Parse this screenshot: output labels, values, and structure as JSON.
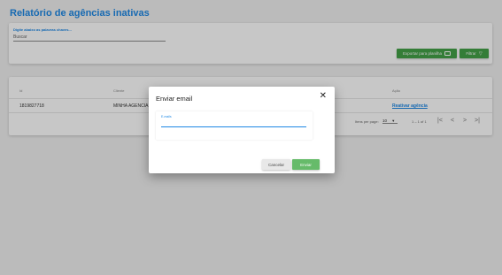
{
  "header": {
    "title": "Relatório de agências inativas"
  },
  "search": {
    "hint": "Digite abaixo as palavras chaves...",
    "label": "Buscar"
  },
  "actions": {
    "export_label": "Exportar para planilha",
    "filter_label": "Filtrar"
  },
  "table": {
    "columns": [
      "Id",
      "Cliente",
      "Ação"
    ],
    "rows": [
      {
        "id": "1819827718",
        "client": "MINHA AGENCIA",
        "action": "Reativar agência"
      }
    ]
  },
  "pagination": {
    "items_per_page_label": "Itens per page:",
    "items_per_page": "10",
    "range": "1 – 1 of 1"
  },
  "dialog": {
    "title": "Enviar email",
    "email_label": "E-mails",
    "email_value": "",
    "cancel_label": "Cancelar",
    "send_label": "Enviar"
  },
  "colors": {
    "accent": "#1e88e5",
    "green": "#43a047",
    "send_green": "#66bb6a"
  }
}
